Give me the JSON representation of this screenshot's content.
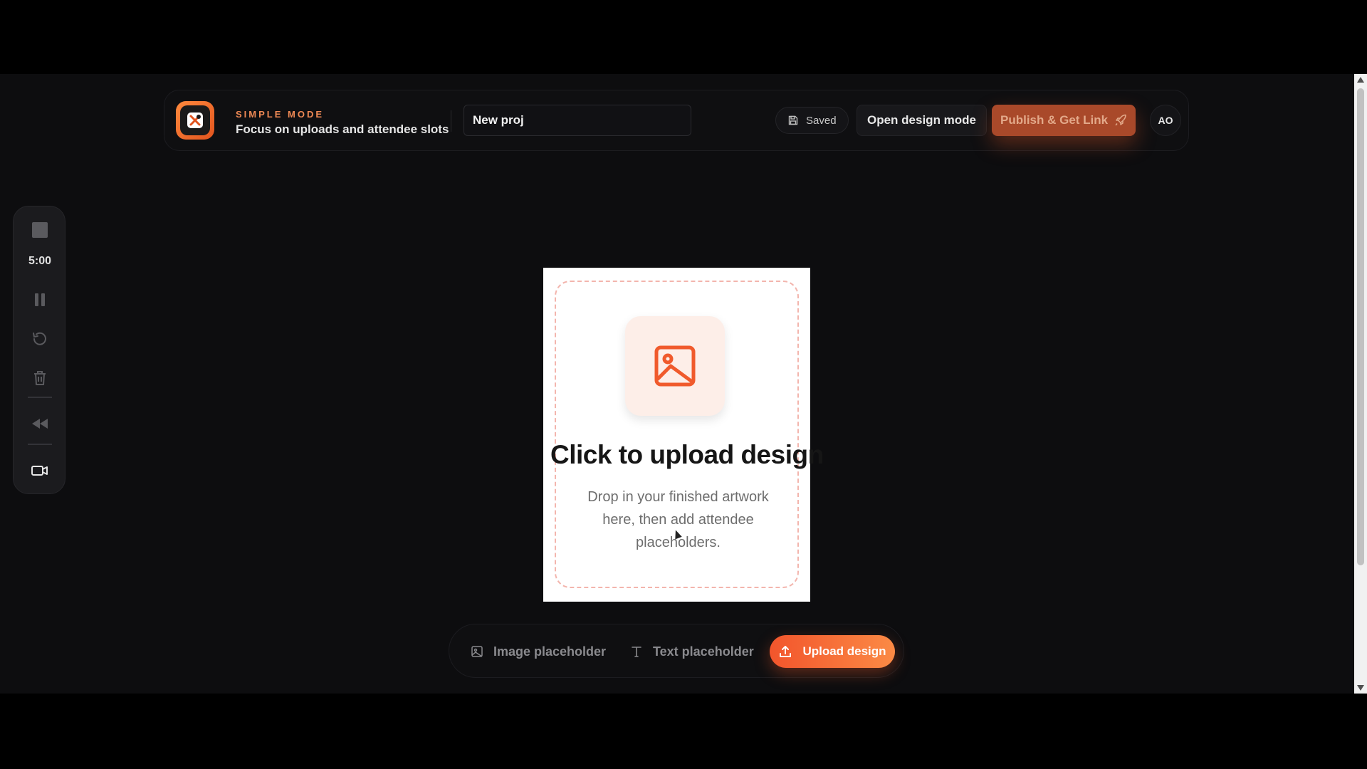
{
  "header": {
    "mode_label": "SIMPLE MODE",
    "mode_subtitle": "Focus on uploads and attendee slots",
    "project_name": "New proj",
    "saved_status": "Saved",
    "open_design_label": "Open design mode",
    "publish_label": "Publish & Get Link",
    "avatar_initials": "AO"
  },
  "recorder": {
    "timer": "5:00",
    "icons": [
      "stop-icon",
      "pause-icon",
      "restart-icon",
      "trash-icon",
      "rewind-icon",
      "camera-icon"
    ]
  },
  "canvas": {
    "title": "Click to upload design",
    "description": "Drop in your finished artwork here, then add attendee placeholders."
  },
  "bottom_bar": {
    "image_placeholder_label": "Image placeholder",
    "text_placeholder_label": "Text placeholder",
    "upload_label": "Upload design"
  },
  "colors": {
    "accent": "#f2552c",
    "accent_light": "#fb8a45",
    "background": "#0d0d0f"
  }
}
